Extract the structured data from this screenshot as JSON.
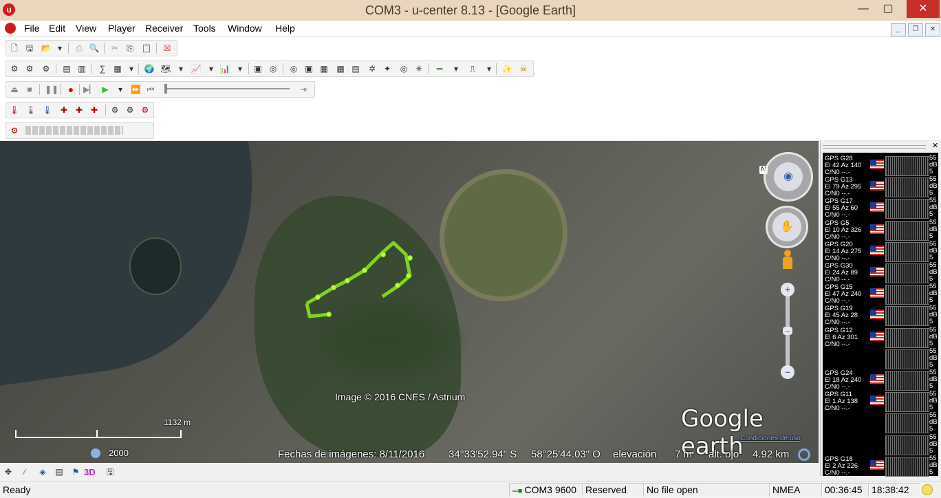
{
  "window": {
    "title": "COM3 - u-center 8.13 - [Google Earth]",
    "app_icon": "u",
    "minimize": "—",
    "maximize": "▢",
    "close": "✕"
  },
  "menu": [
    "File",
    "Edit",
    "View",
    "Player",
    "Receiver",
    "Tools",
    "Window",
    "Help"
  ],
  "map": {
    "attribution": "Image © 2016 CNES / Astrium",
    "logo": "Google earth",
    "terms": "Condiciones de uso",
    "scale_label": "1132 m",
    "year": "2000",
    "imagery_date": "Fechas de imágenes: 8/11/2016",
    "lat": "34°33'52.94\" S",
    "lon": "58°25'44.03\" O",
    "elevation_label": "elevación",
    "elevation": "7 m",
    "eye_label": "alt. ojo",
    "eye_alt": "4.92 km",
    "track_color": "#7fd321"
  },
  "satellites": [
    {
      "name": "GPS G28",
      "el": "El 42 Az 140",
      "cn": "C/N0 --.-"
    },
    {
      "name": "GPS G13",
      "el": "El 79 Az 295",
      "cn": "C/N0 --.-"
    },
    {
      "name": "GPS G17",
      "el": "El 55 Az 60",
      "cn": "C/N0 --.-"
    },
    {
      "name": "GPS G5",
      "el": "El 10 Az 326",
      "cn": "C/N0 --.-"
    },
    {
      "name": "GPS G20",
      "el": "El 14 Az 275",
      "cn": "C/N0 --.-"
    },
    {
      "name": "GPS G30",
      "el": "El 24 Az 89",
      "cn": "C/N0 --.-"
    },
    {
      "name": "GPS G15",
      "el": "El 47 Az 240",
      "cn": "C/N0 --.-"
    },
    {
      "name": "GPS G19",
      "el": "El 45 Az 28",
      "cn": "C/N0 --.-"
    },
    {
      "name": "GPS G12",
      "el": "El 6 Az 301",
      "cn": "C/N0 --.-"
    },
    {
      "name": "",
      "el": "",
      "cn": ""
    },
    {
      "name": "GPS G24",
      "el": "El 18 Az 240",
      "cn": "C/N0 --.-"
    },
    {
      "name": "GPS G11",
      "el": "El 1 Az 138",
      "cn": "C/N0 --.-"
    },
    {
      "name": "",
      "el": "",
      "cn": ""
    },
    {
      "name": "",
      "el": "",
      "cn": ""
    },
    {
      "name": "GPS G18",
      "el": "El 2 Az 226",
      "cn": "C/N0 --.-"
    }
  ],
  "sat_db": "55 dB 5",
  "bottom_tools": {
    "view3d": "3D"
  },
  "status": {
    "ready": "Ready",
    "port": "COM3 9600",
    "reserved": "Reserved",
    "file": "No file open",
    "protocol": "NMEA",
    "elapsed": "00:36:45",
    "clock": "18:38:42"
  }
}
